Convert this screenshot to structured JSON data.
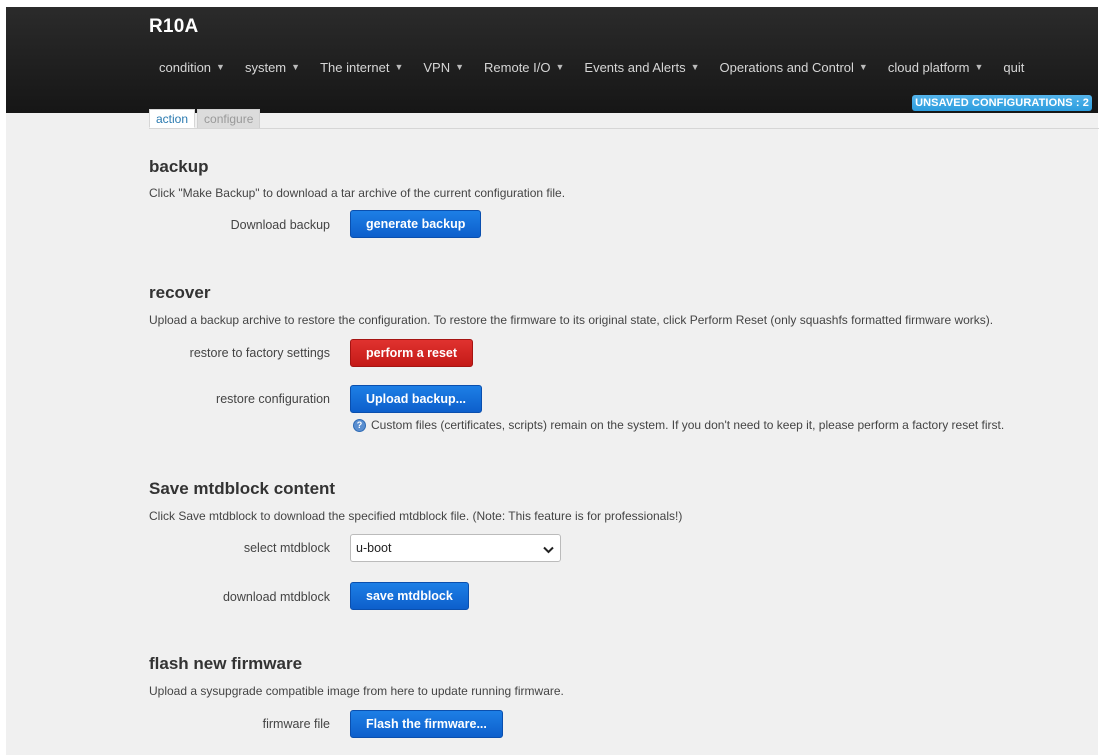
{
  "app": {
    "title": "R10A"
  },
  "nav": [
    {
      "label": "condition",
      "dropdown": true
    },
    {
      "label": "system",
      "dropdown": true
    },
    {
      "label": "The internet",
      "dropdown": true
    },
    {
      "label": "VPN",
      "dropdown": true
    },
    {
      "label": "Remote I/O",
      "dropdown": true
    },
    {
      "label": "Events and Alerts",
      "dropdown": true
    },
    {
      "label": "Operations and Control",
      "dropdown": true
    },
    {
      "label": "cloud platform",
      "dropdown": true
    },
    {
      "label": "quit",
      "dropdown": false
    }
  ],
  "badge": {
    "text": "UNSAVED CONFIGURATIONS : 2"
  },
  "tabs": {
    "active": "action",
    "inactive": "configure"
  },
  "backup": {
    "title": "backup",
    "desc": "Click \"Make Backup\" to download a tar archive of the current configuration file.",
    "download_label": "Download backup",
    "generate_btn": "generate backup"
  },
  "recover": {
    "title": "recover",
    "desc": "Upload a backup archive to restore the configuration. To restore the firmware to its original state, click Perform Reset (only squashfs formatted firmware works).",
    "factory_label": "restore to factory settings",
    "reset_btn": "perform a reset",
    "restore_label": "restore configuration",
    "upload_btn": "Upload backup...",
    "hint": "Custom files (certificates, scripts) remain on the system. If you don't need to keep it, please perform a factory reset first."
  },
  "mtd": {
    "title": "Save mtdblock content",
    "desc": "Click Save mtdblock to download the specified mtdblock file. (Note: This feature is for professionals!)",
    "select_label": "select mtdblock",
    "select_value": "u-boot",
    "download_label": "download mtdblock",
    "save_btn": "save mtdblock"
  },
  "firmware": {
    "title": "flash new firmware",
    "desc": "Upload a sysupgrade compatible image from here to update running firmware.",
    "file_label": "firmware file",
    "flash_btn": "Flash the firmware..."
  },
  "icons": {
    "dropdown": "caret-down-icon",
    "help": "help-icon",
    "select": "chevron-down-icon"
  },
  "colors": {
    "header": "#1f1f1f",
    "primary_button": "#1565d8",
    "danger_button": "#d42a27",
    "badge": "#3aa5e8"
  }
}
